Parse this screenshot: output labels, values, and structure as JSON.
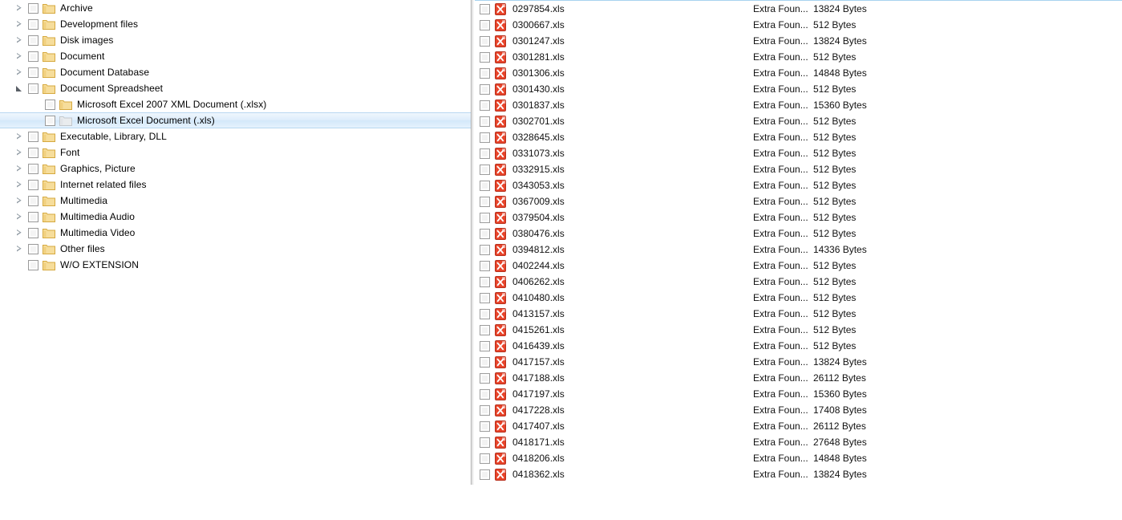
{
  "colors": {
    "folder_fill": "#f7e0a0",
    "folder_edge": "#d9b24c",
    "xls_red": "#e8442a",
    "selection_blue": "#d3e8fa",
    "selection_border": "#b8d6f0",
    "panel_top_rule": "#a8d3ef",
    "splitter": "#a6a6a6"
  },
  "tree": {
    "items": [
      {
        "label": "Archive",
        "depth": 0,
        "expander": "collapsed",
        "selected": false,
        "checked": false
      },
      {
        "label": "Development files",
        "depth": 0,
        "expander": "collapsed",
        "selected": false,
        "checked": false
      },
      {
        "label": "Disk images",
        "depth": 0,
        "expander": "collapsed",
        "selected": false,
        "checked": false
      },
      {
        "label": "Document",
        "depth": 0,
        "expander": "collapsed",
        "selected": false,
        "checked": false
      },
      {
        "label": "Document Database",
        "depth": 0,
        "expander": "collapsed",
        "selected": false,
        "checked": false
      },
      {
        "label": "Document Spreadsheet",
        "depth": 0,
        "expander": "expanded",
        "selected": false,
        "checked": false
      },
      {
        "label": "Microsoft Excel 2007 XML Document (.xlsx)",
        "depth": 1,
        "expander": "none",
        "selected": false,
        "checked": false
      },
      {
        "label": "Microsoft Excel Document (.xls)",
        "depth": 1,
        "expander": "none",
        "selected": true,
        "checked": false
      },
      {
        "label": "Executable, Library, DLL",
        "depth": 0,
        "expander": "collapsed",
        "selected": false,
        "checked": false
      },
      {
        "label": "Font",
        "depth": 0,
        "expander": "collapsed",
        "selected": false,
        "checked": false
      },
      {
        "label": "Graphics, Picture",
        "depth": 0,
        "expander": "collapsed",
        "selected": false,
        "checked": false
      },
      {
        "label": "Internet related files",
        "depth": 0,
        "expander": "collapsed",
        "selected": false,
        "checked": false
      },
      {
        "label": "Multimedia",
        "depth": 0,
        "expander": "collapsed",
        "selected": false,
        "checked": false
      },
      {
        "label": "Multimedia Audio",
        "depth": 0,
        "expander": "collapsed",
        "selected": false,
        "checked": false
      },
      {
        "label": "Multimedia Video",
        "depth": 0,
        "expander": "collapsed",
        "selected": false,
        "checked": false
      },
      {
        "label": "Other files",
        "depth": 0,
        "expander": "collapsed",
        "selected": false,
        "checked": false
      },
      {
        "label": "W/O EXTENSION",
        "depth": 0,
        "expander": "none",
        "selected": false,
        "checked": false
      }
    ]
  },
  "files": {
    "icon_name": "excel-file-icon",
    "rows": [
      {
        "name": "0297854.xls",
        "status": "Extra Foun...",
        "size": "13824 Bytes",
        "checked": false
      },
      {
        "name": "0300667.xls",
        "status": "Extra Foun...",
        "size": "512 Bytes",
        "checked": false
      },
      {
        "name": "0301247.xls",
        "status": "Extra Foun...",
        "size": "13824 Bytes",
        "checked": false
      },
      {
        "name": "0301281.xls",
        "status": "Extra Foun...",
        "size": "512 Bytes",
        "checked": false
      },
      {
        "name": "0301306.xls",
        "status": "Extra Foun...",
        "size": "14848 Bytes",
        "checked": false
      },
      {
        "name": "0301430.xls",
        "status": "Extra Foun...",
        "size": "512 Bytes",
        "checked": false
      },
      {
        "name": "0301837.xls",
        "status": "Extra Foun...",
        "size": "15360 Bytes",
        "checked": false
      },
      {
        "name": "0302701.xls",
        "status": "Extra Foun...",
        "size": "512 Bytes",
        "checked": false
      },
      {
        "name": "0328645.xls",
        "status": "Extra Foun...",
        "size": "512 Bytes",
        "checked": false
      },
      {
        "name": "0331073.xls",
        "status": "Extra Foun...",
        "size": "512 Bytes",
        "checked": false
      },
      {
        "name": "0332915.xls",
        "status": "Extra Foun...",
        "size": "512 Bytes",
        "checked": false
      },
      {
        "name": "0343053.xls",
        "status": "Extra Foun...",
        "size": "512 Bytes",
        "checked": false
      },
      {
        "name": "0367009.xls",
        "status": "Extra Foun...",
        "size": "512 Bytes",
        "checked": false
      },
      {
        "name": "0379504.xls",
        "status": "Extra Foun...",
        "size": "512 Bytes",
        "checked": false
      },
      {
        "name": "0380476.xls",
        "status": "Extra Foun...",
        "size": "512 Bytes",
        "checked": false
      },
      {
        "name": "0394812.xls",
        "status": "Extra Foun...",
        "size": "14336 Bytes",
        "checked": false
      },
      {
        "name": "0402244.xls",
        "status": "Extra Foun...",
        "size": "512 Bytes",
        "checked": false
      },
      {
        "name": "0406262.xls",
        "status": "Extra Foun...",
        "size": "512 Bytes",
        "checked": false
      },
      {
        "name": "0410480.xls",
        "status": "Extra Foun...",
        "size": "512 Bytes",
        "checked": false
      },
      {
        "name": "0413157.xls",
        "status": "Extra Foun...",
        "size": "512 Bytes",
        "checked": false
      },
      {
        "name": "0415261.xls",
        "status": "Extra Foun...",
        "size": "512 Bytes",
        "checked": false
      },
      {
        "name": "0416439.xls",
        "status": "Extra Foun...",
        "size": "512 Bytes",
        "checked": false
      },
      {
        "name": "0417157.xls",
        "status": "Extra Foun...",
        "size": "13824 Bytes",
        "checked": false
      },
      {
        "name": "0417188.xls",
        "status": "Extra Foun...",
        "size": "26112 Bytes",
        "checked": false
      },
      {
        "name": "0417197.xls",
        "status": "Extra Foun...",
        "size": "15360 Bytes",
        "checked": false
      },
      {
        "name": "0417228.xls",
        "status": "Extra Foun...",
        "size": "17408 Bytes",
        "checked": false
      },
      {
        "name": "0417407.xls",
        "status": "Extra Foun...",
        "size": "26112 Bytes",
        "checked": false
      },
      {
        "name": "0418171.xls",
        "status": "Extra Foun...",
        "size": "27648 Bytes",
        "checked": false
      },
      {
        "name": "0418206.xls",
        "status": "Extra Foun...",
        "size": "14848 Bytes",
        "checked": false
      },
      {
        "name": "0418362.xls",
        "status": "Extra Foun...",
        "size": "13824 Bytes",
        "checked": false
      }
    ]
  }
}
